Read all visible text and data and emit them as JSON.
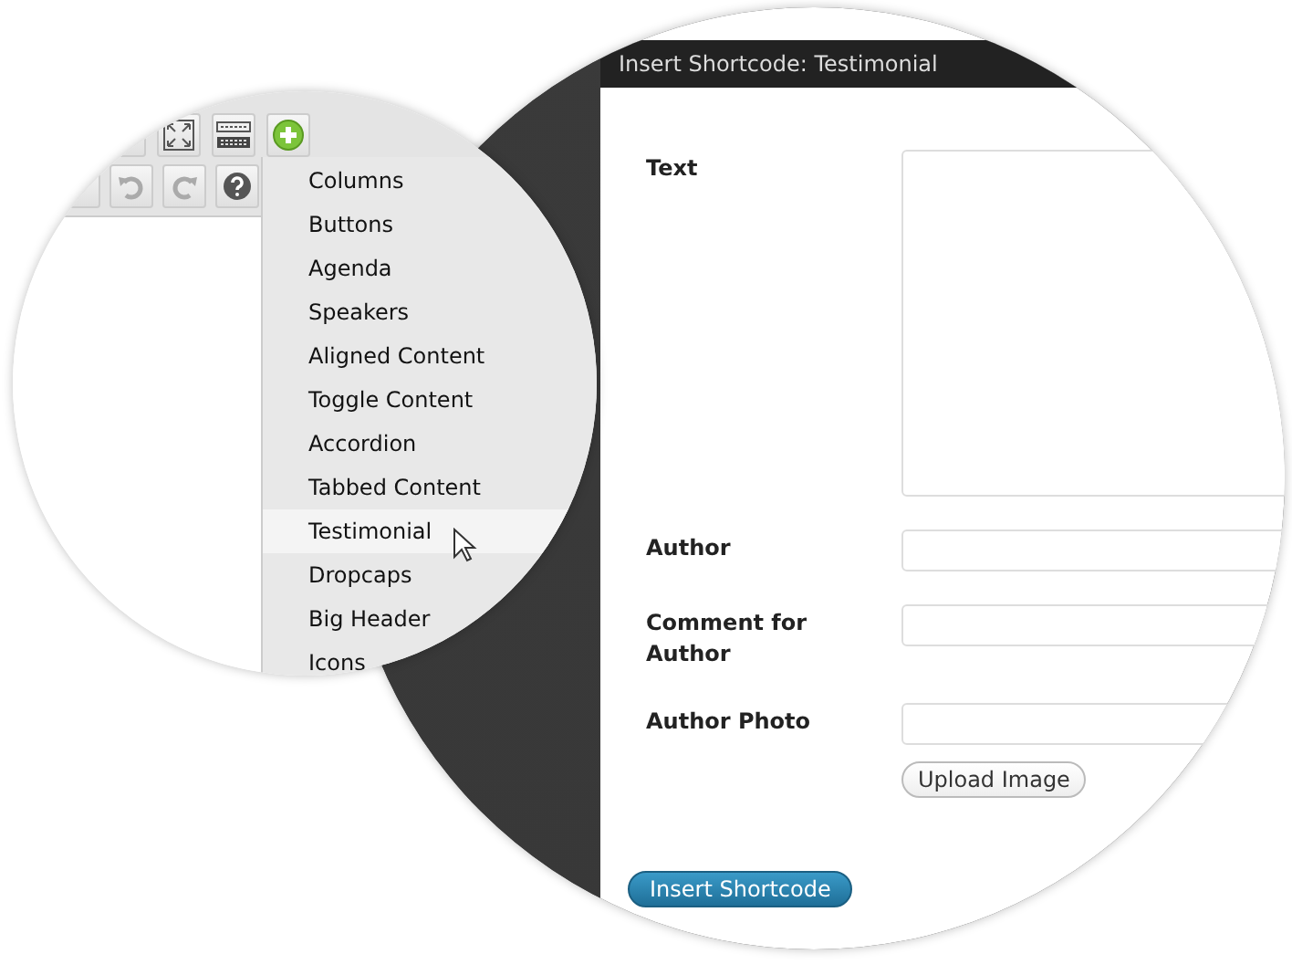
{
  "shortcode_menu": {
    "items": [
      {
        "label": "Columns",
        "selected": false
      },
      {
        "label": "Buttons",
        "selected": false
      },
      {
        "label": "Agenda",
        "selected": false
      },
      {
        "label": "Speakers",
        "selected": false
      },
      {
        "label": "Aligned Content",
        "selected": false
      },
      {
        "label": "Toggle Content",
        "selected": false
      },
      {
        "label": "Accordion",
        "selected": false
      },
      {
        "label": "Tabbed Content",
        "selected": false
      },
      {
        "label": "Testimonial",
        "selected": true
      },
      {
        "label": "Dropcaps",
        "selected": false
      },
      {
        "label": "Big Header",
        "selected": false
      },
      {
        "label": "Icons",
        "selected": false
      }
    ]
  },
  "dialog": {
    "title": "Insert Shortcode: Testimonial",
    "fields": [
      {
        "label": "Text",
        "kind": "textarea"
      },
      {
        "label": "Author",
        "kind": "text"
      },
      {
        "label": "Comment for Author",
        "kind": "text"
      },
      {
        "label": "Author Photo",
        "kind": "upload",
        "button": "Upload Image"
      }
    ],
    "submit_button": "Insert Shortcode"
  }
}
